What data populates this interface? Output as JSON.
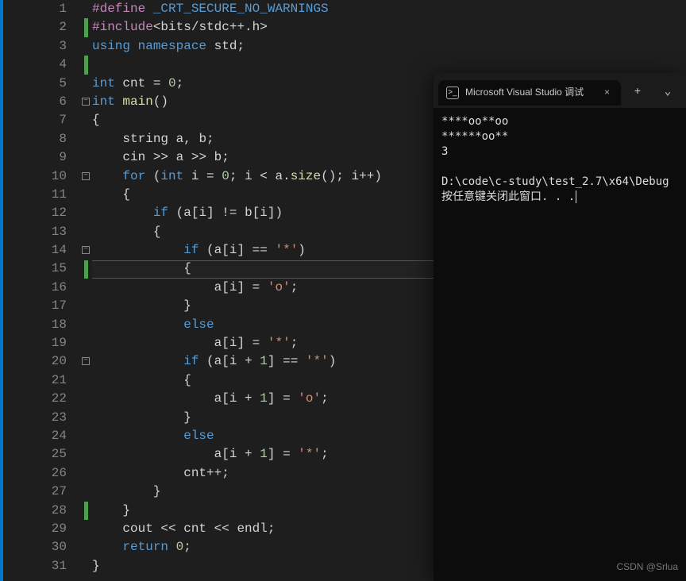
{
  "editor": {
    "lineNumbers": [
      "1",
      "2",
      "3",
      "4",
      "5",
      "6",
      "7",
      "8",
      "9",
      "10",
      "11",
      "12",
      "13",
      "14",
      "15",
      "16",
      "17",
      "18",
      "19",
      "20",
      "21",
      "22",
      "23",
      "24",
      "25",
      "26",
      "27",
      "28",
      "29",
      "30",
      "31"
    ],
    "greenMarkLines": [
      2,
      4,
      15,
      28
    ],
    "highlightLine": 15,
    "foldLines": {
      "6": "-",
      "10": "-",
      "14": "-",
      "20": "-"
    },
    "codeTokens": [
      [
        [
          "pp",
          "#define "
        ],
        [
          "macro",
          "_CRT_SECURE_NO_WARNINGS"
        ]
      ],
      [
        [
          "pp",
          "#include"
        ],
        [
          "op",
          "<"
        ],
        [
          "ident",
          "bits"
        ],
        [
          "op",
          "/"
        ],
        [
          "ident",
          "stdc"
        ],
        [
          "op",
          "++."
        ],
        [
          "ident",
          "h"
        ],
        [
          "op",
          ">"
        ]
      ],
      [
        [
          "kw",
          "using "
        ],
        [
          "kw",
          "namespace "
        ],
        [
          "ident",
          "std"
        ],
        [
          "punc",
          ";"
        ]
      ],
      [],
      [
        [
          "kw",
          "int "
        ],
        [
          "ident",
          "cnt"
        ],
        [
          "op",
          " = "
        ],
        [
          "num",
          "0"
        ],
        [
          "punc",
          ";"
        ]
      ],
      [
        [
          "kw",
          "int "
        ],
        [
          "fn",
          "main"
        ],
        [
          "punc",
          "()"
        ]
      ],
      [
        [
          "punc",
          "{"
        ]
      ],
      [
        [
          "ident",
          "    string "
        ],
        [
          "ident",
          "a"
        ],
        [
          "punc",
          ", "
        ],
        [
          "ident",
          "b"
        ],
        [
          "punc",
          ";"
        ]
      ],
      [
        [
          "ident",
          "    cin"
        ],
        [
          "op",
          " >> "
        ],
        [
          "ident",
          "a"
        ],
        [
          "op",
          " >> "
        ],
        [
          "ident",
          "b"
        ],
        [
          "punc",
          ";"
        ]
      ],
      [
        [
          "kw",
          "    for "
        ],
        [
          "punc",
          "("
        ],
        [
          "kw",
          "int "
        ],
        [
          "ident",
          "i"
        ],
        [
          "op",
          " = "
        ],
        [
          "num",
          "0"
        ],
        [
          "punc",
          "; "
        ],
        [
          "ident",
          "i"
        ],
        [
          "op",
          " < "
        ],
        [
          "ident",
          "a"
        ],
        [
          "punc",
          "."
        ],
        [
          "fn",
          "size"
        ],
        [
          "punc",
          "(); "
        ],
        [
          "ident",
          "i"
        ],
        [
          "op",
          "++"
        ],
        [
          "punc",
          ")"
        ]
      ],
      [
        [
          "punc",
          "    {"
        ]
      ],
      [
        [
          "kw",
          "        if "
        ],
        [
          "punc",
          "("
        ],
        [
          "ident",
          "a"
        ],
        [
          "punc",
          "["
        ],
        [
          "ident",
          "i"
        ],
        [
          "punc",
          "]"
        ],
        [
          "op",
          " != "
        ],
        [
          "ident",
          "b"
        ],
        [
          "punc",
          "["
        ],
        [
          "ident",
          "i"
        ],
        [
          "punc",
          "])"
        ]
      ],
      [
        [
          "punc",
          "        {"
        ]
      ],
      [
        [
          "kw",
          "            if "
        ],
        [
          "punc",
          "("
        ],
        [
          "ident",
          "a"
        ],
        [
          "punc",
          "["
        ],
        [
          "ident",
          "i"
        ],
        [
          "punc",
          "]"
        ],
        [
          "op",
          " == "
        ],
        [
          "str",
          "'*'"
        ],
        [
          "punc",
          ")"
        ]
      ],
      [
        [
          "punc",
          "            {"
        ]
      ],
      [
        [
          "ident",
          "                a"
        ],
        [
          "punc",
          "["
        ],
        [
          "ident",
          "i"
        ],
        [
          "punc",
          "]"
        ],
        [
          "op",
          " = "
        ],
        [
          "str",
          "'o'"
        ],
        [
          "punc",
          ";"
        ]
      ],
      [
        [
          "punc",
          "            }"
        ]
      ],
      [
        [
          "kw",
          "            else"
        ]
      ],
      [
        [
          "ident",
          "                a"
        ],
        [
          "punc",
          "["
        ],
        [
          "ident",
          "i"
        ],
        [
          "punc",
          "]"
        ],
        [
          "op",
          " = "
        ],
        [
          "str",
          "'*'"
        ],
        [
          "punc",
          ";"
        ]
      ],
      [
        [
          "kw",
          "            if "
        ],
        [
          "punc",
          "("
        ],
        [
          "ident",
          "a"
        ],
        [
          "punc",
          "["
        ],
        [
          "ident",
          "i"
        ],
        [
          "op",
          " + "
        ],
        [
          "num",
          "1"
        ],
        [
          "punc",
          "]"
        ],
        [
          "op",
          " == "
        ],
        [
          "str",
          "'*'"
        ],
        [
          "punc",
          ")"
        ]
      ],
      [
        [
          "punc",
          "            {"
        ]
      ],
      [
        [
          "ident",
          "                a"
        ],
        [
          "punc",
          "["
        ],
        [
          "ident",
          "i"
        ],
        [
          "op",
          " + "
        ],
        [
          "num",
          "1"
        ],
        [
          "punc",
          "]"
        ],
        [
          "op",
          " = "
        ],
        [
          "str",
          "'o'"
        ],
        [
          "punc",
          ";"
        ]
      ],
      [
        [
          "punc",
          "            }"
        ]
      ],
      [
        [
          "kw",
          "            else"
        ]
      ],
      [
        [
          "ident",
          "                a"
        ],
        [
          "punc",
          "["
        ],
        [
          "ident",
          "i"
        ],
        [
          "op",
          " + "
        ],
        [
          "num",
          "1"
        ],
        [
          "punc",
          "]"
        ],
        [
          "op",
          " = "
        ],
        [
          "str",
          "'*'"
        ],
        [
          "punc",
          ";"
        ]
      ],
      [
        [
          "ident",
          "            cnt"
        ],
        [
          "op",
          "++"
        ],
        [
          "punc",
          ";"
        ]
      ],
      [
        [
          "punc",
          "        }"
        ]
      ],
      [
        [
          "punc",
          "    }"
        ]
      ],
      [
        [
          "ident",
          "    cout"
        ],
        [
          "op",
          " << "
        ],
        [
          "ident",
          "cnt"
        ],
        [
          "op",
          " << "
        ],
        [
          "ident",
          "endl"
        ],
        [
          "punc",
          ";"
        ]
      ],
      [
        [
          "kw",
          "    return "
        ],
        [
          "num",
          "0"
        ],
        [
          "punc",
          ";"
        ]
      ],
      [
        [
          "punc",
          "}"
        ]
      ]
    ]
  },
  "terminal": {
    "tabTitle": "Microsoft Visual Studio 调试",
    "plusLabel": "+",
    "chevron": "⌄",
    "closeLabel": "×",
    "output": [
      "****oo**oo",
      "******oo**",
      "3",
      "",
      "D:\\code\\c-study\\test_2.7\\x64\\Debug",
      "按任意键关闭此窗口. . ."
    ]
  },
  "watermark": "CSDN @Srlua"
}
